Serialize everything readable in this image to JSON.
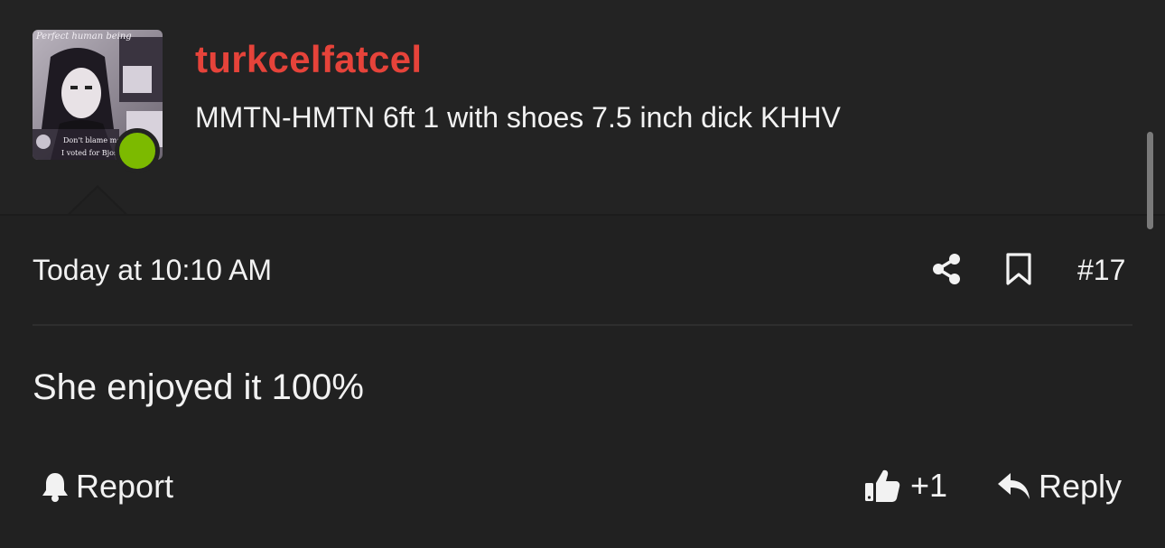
{
  "user": {
    "username": "turkcelfatcel",
    "title": "MMTN-HMTN 6ft 1 with shoes 7.5 inch dick KHHV",
    "online": true,
    "avatar": {
      "caption_top": "Perfect human being",
      "caption_bottom_1": "Don't blame me,",
      "caption_bottom_2": "I voted for Bjose"
    }
  },
  "post": {
    "timestamp": "Today at 10:10 AM",
    "number": "#17",
    "message": "She enjoyed it 100%"
  },
  "actions": {
    "report_label": "Report",
    "like_count": "+1",
    "reply_label": "Reply"
  },
  "colors": {
    "accent_username": "#e6433a",
    "online": "#7cba00",
    "background": "#232323"
  },
  "icons": [
    "share-icon",
    "bookmark-icon",
    "bell-icon",
    "thumbs-up-icon",
    "reply-arrow-icon"
  ]
}
